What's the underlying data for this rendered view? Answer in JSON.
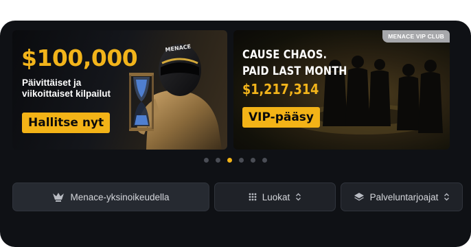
{
  "promo_banners": [
    {
      "amount": "$100,000",
      "subtitle": "Päivittäiset ja viikoittaiset kilpailut",
      "cta_label": "Hallitse nyt",
      "icons": [
        "racer-with-hourglass-image"
      ]
    },
    {
      "tag": "MENACE VIP CLUB",
      "headline_line1": "CAUSE CHAOS.",
      "headline_line2": "PAID LAST MONTH",
      "amount": "$1,217,314",
      "cta_label": "VIP-pääsy",
      "icons": [
        "vip-silhouettes-image"
      ]
    }
  ],
  "carousel": {
    "total_dots": 6,
    "active_index": 2
  },
  "filters": {
    "exclusive_label": "Menace-yksinoikeudella",
    "categories_label": "Luokat",
    "providers_label": "Palveluntarjoajat"
  },
  "colors": {
    "accent": "#f3b317",
    "background": "#0f1115",
    "pill": "#1f2228"
  }
}
